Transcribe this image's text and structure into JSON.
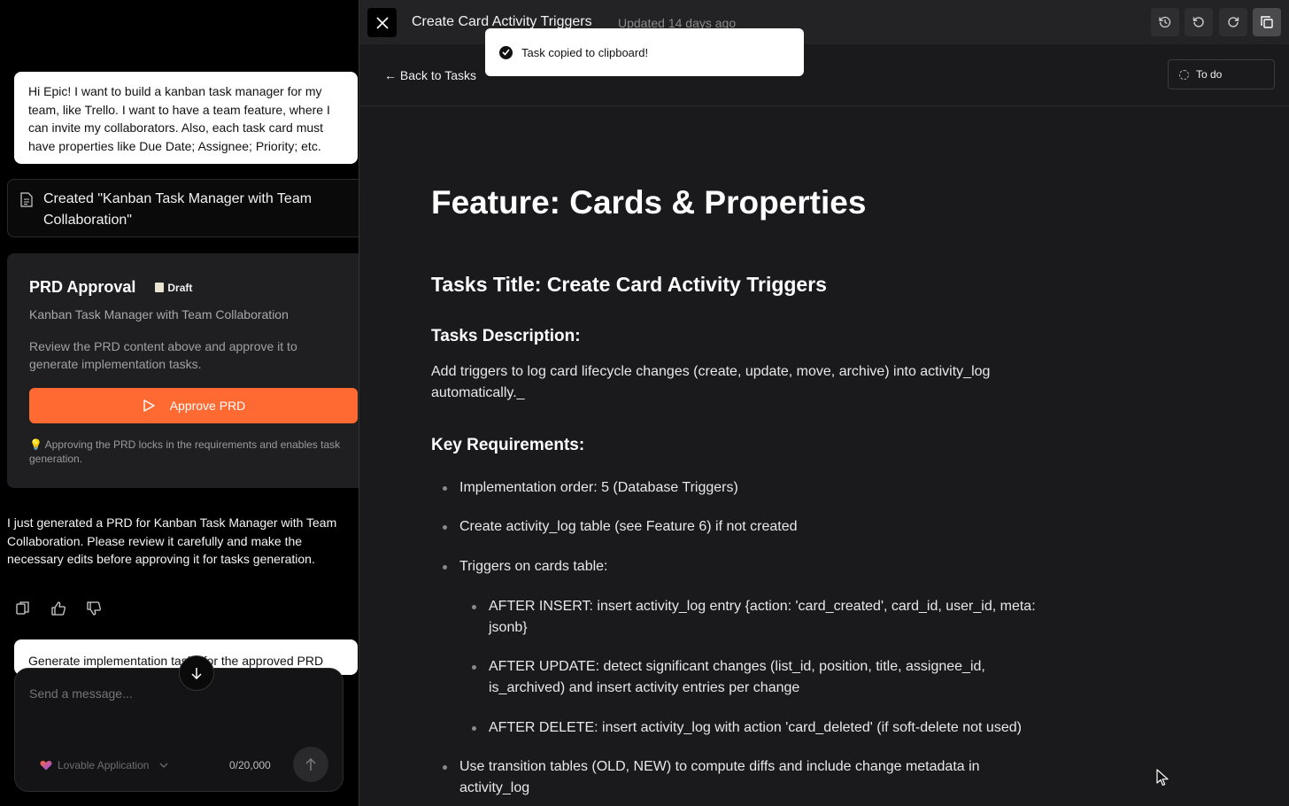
{
  "chat": {
    "user_message_1": "Hi Epic! I want to build a kanban task manager for my team, like Trello. I want to have a team feature, where I can invite my collaborators. Also, each task card must have properties like Due Date; Assignee; Priority; etc.",
    "created_notice": "Created \"Kanban Task Manager with Team Collaboration\"",
    "prd_card": {
      "title": "PRD Approval",
      "badge": "Draft",
      "subtitle": "Kanban Task Manager with Team Collaboration",
      "description": "Review the PRD content above and approve it to generate implementation tasks.",
      "approve_label": "Approve PRD",
      "note": "💡 Approving the PRD locks in the requirements and enables task generation."
    },
    "assistant_message": "I just generated a PRD for Kanban Task Manager with Team Collaboration. Please review it carefully and make the necessary edits before approving it for tasks generation.",
    "user_message_2": "Generate implementation tasks for the approved PRD",
    "composer": {
      "placeholder": "Send a message...",
      "project": "Lovable Application",
      "char_count": "0/20,000"
    }
  },
  "editor": {
    "title": "Create Card Activity Triggers",
    "updated": "Updated 14 days ago",
    "back_label": "← Back to Tasks",
    "status": "To do",
    "toast": "Task copied to clipboard!",
    "doc": {
      "h1": "Feature: Cards & Properties",
      "h2": "Tasks Title: Create Card Activity Triggers",
      "desc_heading": "Tasks Description:",
      "description": "Add triggers to log card lifecycle changes (create, update, move, archive) into activity_log automatically._",
      "req_heading": "Key Requirements:",
      "requirements": [
        "Implementation order: 5 (Database Triggers)",
        "Create activity_log table (see Feature 6) if not created",
        "Triggers on cards table:",
        "AFTER INSERT: insert activity_log entry {action: 'card_created', card_id, user_id, meta: jsonb}",
        "AFTER UPDATE: detect significant changes (list_id, position, title, assignee_id, is_archived) and insert activity entries per change",
        "AFTER DELETE: insert activity_log with action 'card_deleted' (if soft-delete not used)",
        "Use transition tables (OLD, NEW) to compute diffs and include change metadata in activity_log"
      ]
    }
  },
  "colors": {
    "accent": "#ff6a33",
    "panel_bg": "#1a1a1c",
    "card_bg": "#1f1f21"
  }
}
